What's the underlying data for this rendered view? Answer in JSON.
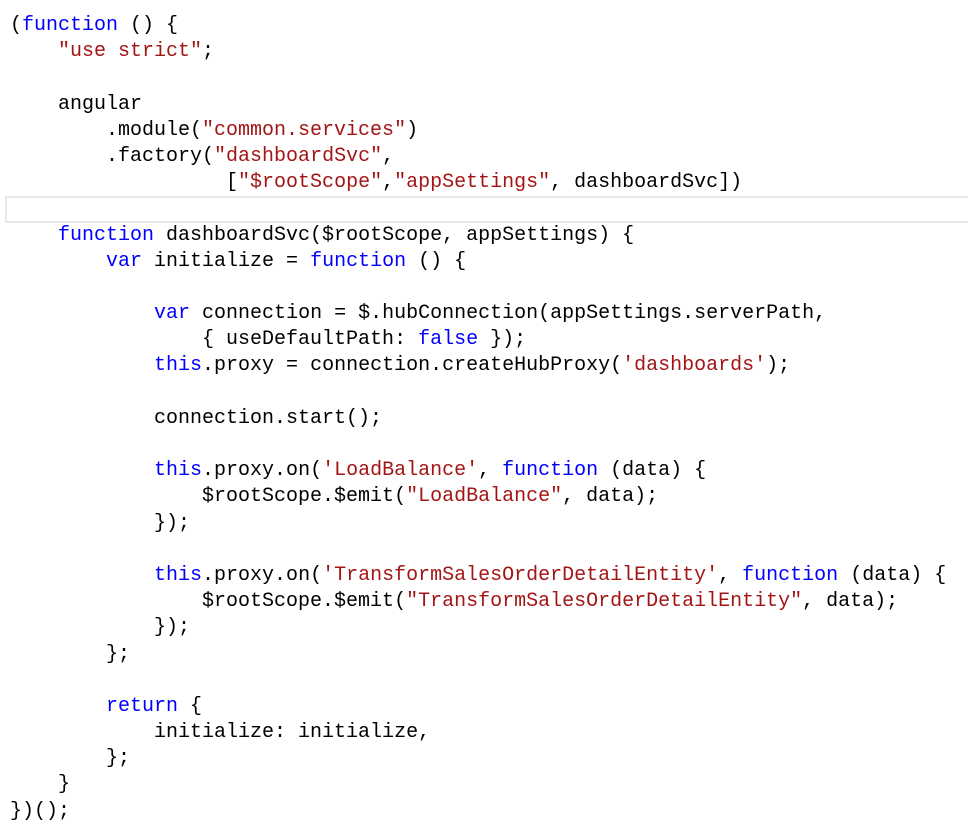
{
  "editor": {
    "colors": {
      "keyword": "#0000ff",
      "string": "#a31515",
      "text": "#000000",
      "current_line_border": "#e8e8e8"
    },
    "current_line": 8,
    "lines": [
      [
        [
          "txt",
          "("
        ],
        [
          "kw",
          "function"
        ],
        [
          "txt",
          " () {"
        ]
      ],
      [
        [
          "txt",
          "    "
        ],
        [
          "str",
          "\"use strict\""
        ],
        [
          "txt",
          ";"
        ]
      ],
      [],
      [
        [
          "txt",
          "    angular"
        ]
      ],
      [
        [
          "txt",
          "        .module("
        ],
        [
          "str",
          "\"common.services\""
        ],
        [
          "txt",
          ")"
        ]
      ],
      [
        [
          "txt",
          "        .factory("
        ],
        [
          "str",
          "\"dashboardSvc\""
        ],
        [
          "txt",
          ","
        ]
      ],
      [
        [
          "txt",
          "                  ["
        ],
        [
          "str",
          "\"$rootScope\""
        ],
        [
          "txt",
          ","
        ],
        [
          "str",
          "\"appSettings\""
        ],
        [
          "txt",
          ", dashboardSvc])"
        ]
      ],
      [],
      [
        [
          "txt",
          "    "
        ],
        [
          "kw",
          "function"
        ],
        [
          "txt",
          " dashboardSvc($rootScope, appSettings) {"
        ]
      ],
      [
        [
          "txt",
          "        "
        ],
        [
          "kw",
          "var"
        ],
        [
          "txt",
          " initialize = "
        ],
        [
          "kw",
          "function"
        ],
        [
          "txt",
          " () {"
        ]
      ],
      [],
      [
        [
          "txt",
          "            "
        ],
        [
          "kw",
          "var"
        ],
        [
          "txt",
          " connection = $.hubConnection(appSettings.serverPath,"
        ]
      ],
      [
        [
          "txt",
          "                { useDefaultPath: "
        ],
        [
          "kw",
          "false"
        ],
        [
          "txt",
          " });"
        ]
      ],
      [
        [
          "txt",
          "            "
        ],
        [
          "kw",
          "this"
        ],
        [
          "txt",
          ".proxy = connection.createHubProxy("
        ],
        [
          "str",
          "'dashboards'"
        ],
        [
          "txt",
          ");"
        ]
      ],
      [],
      [
        [
          "txt",
          "            connection.start();"
        ]
      ],
      [],
      [
        [
          "txt",
          "            "
        ],
        [
          "kw",
          "this"
        ],
        [
          "txt",
          ".proxy.on("
        ],
        [
          "str",
          "'LoadBalance'"
        ],
        [
          "txt",
          ", "
        ],
        [
          "kw",
          "function"
        ],
        [
          "txt",
          " (data) {"
        ]
      ],
      [
        [
          "txt",
          "                $rootScope.$emit("
        ],
        [
          "str",
          "\"LoadBalance\""
        ],
        [
          "txt",
          ", data);"
        ]
      ],
      [
        [
          "txt",
          "            });"
        ]
      ],
      [],
      [
        [
          "txt",
          "            "
        ],
        [
          "kw",
          "this"
        ],
        [
          "txt",
          ".proxy.on("
        ],
        [
          "str",
          "'TransformSalesOrderDetailEntity'"
        ],
        [
          "txt",
          ", "
        ],
        [
          "kw",
          "function"
        ],
        [
          "txt",
          " (data) {"
        ]
      ],
      [
        [
          "txt",
          "                $rootScope.$emit("
        ],
        [
          "str",
          "\"TransformSalesOrderDetailEntity\""
        ],
        [
          "txt",
          ", data);"
        ]
      ],
      [
        [
          "txt",
          "            });"
        ]
      ],
      [
        [
          "txt",
          "        };"
        ]
      ],
      [],
      [
        [
          "txt",
          "        "
        ],
        [
          "kw",
          "return"
        ],
        [
          "txt",
          " {"
        ]
      ],
      [
        [
          "txt",
          "            initialize: initialize,"
        ]
      ],
      [
        [
          "txt",
          "        };"
        ]
      ],
      [
        [
          "txt",
          "    }"
        ]
      ],
      [
        [
          "txt",
          "})();"
        ]
      ]
    ]
  }
}
